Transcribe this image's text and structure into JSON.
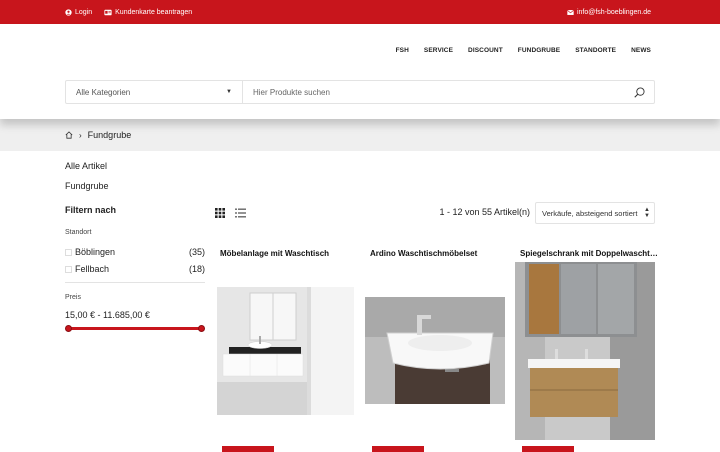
{
  "topbar": {
    "login": "Login",
    "card": "Kundenkarte beantragen",
    "email": "info@fsh-boeblingen.de"
  },
  "nav": [
    "FSH",
    "SERVICE",
    "DISCOUNT",
    "FUNDGRUBE",
    "STANDORTE",
    "NEWS"
  ],
  "search": {
    "category": "Alle Kategorien",
    "placeholder": "Hier Produkte suchen"
  },
  "breadcrumb": {
    "current": "Fundgrube"
  },
  "sidebar": {
    "all_articles": "Alle Artikel",
    "category": "Fundgrube",
    "filter_title": "Filtern nach",
    "location_label": "Standort",
    "locations": [
      {
        "name": "Böblingen",
        "count": "(35)"
      },
      {
        "name": "Fellbach",
        "count": "(18)"
      }
    ],
    "price_label": "Preis",
    "price_range": "15,00 € - 11.685,00 €"
  },
  "listing": {
    "count": "1 - 12 von 55 Artikel(n)",
    "sort": "Verkäufe, absteigend sortiert"
  },
  "products": [
    {
      "title": "Möbelanlage mit Waschtisch"
    },
    {
      "title": "Ardino Waschtischmöbelset"
    },
    {
      "title": "Spiegelschrank mit Doppelwaschtisch"
    }
  ],
  "colors": {
    "accent": "#c8151c",
    "breadcrumb_bg": "#efefef"
  }
}
